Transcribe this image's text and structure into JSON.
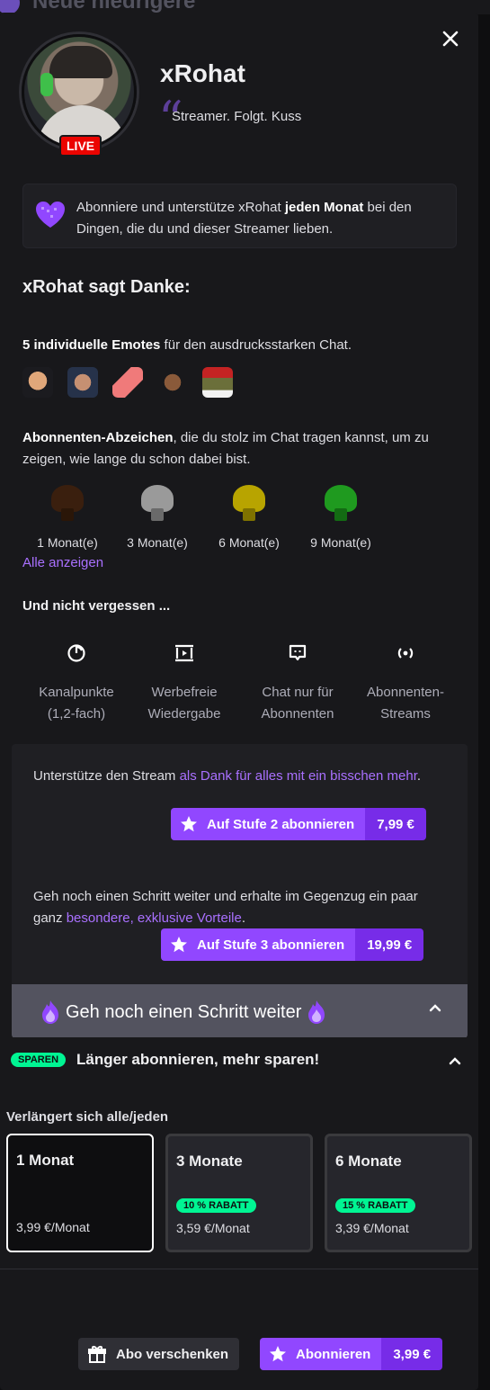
{
  "background_title": "Neue niedrigere",
  "channel": {
    "name": "xRohat",
    "tagline": "Streamer. Folgt. Kuss",
    "live_label": "LIVE"
  },
  "promo": {
    "pre": "Abonniere und unterstütze xRohat ",
    "bold": "jeden Monat",
    "post": " bei den Dingen, die du und dieser Streamer lieben."
  },
  "thanks_title": "xRohat sagt Danke:",
  "emotes_section": {
    "bold": "5 individuelle Emotes",
    "rest": " für den ausdrucksstarken Chat."
  },
  "badges_section": {
    "bold": "Abonnenten-Abzeichen",
    "rest": ", die du stolz im Chat tragen kannst, um zu zeigen, wie lange du schon dabei bist.",
    "badges": [
      {
        "label": "1 Monat(e)",
        "color": "#3a1f0e"
      },
      {
        "label": "3 Monat(e)",
        "color": "#9a9a9a"
      },
      {
        "label": "6 Monat(e)",
        "color": "#b8a400"
      },
      {
        "label": "9 Monat(e)",
        "color": "#1f9a1f"
      }
    ],
    "show_all": "Alle anzeigen"
  },
  "perks_title": "Und nicht vergessen ...",
  "perks": [
    {
      "icon": "clock-icon",
      "line1": "Kanalpunkte",
      "line2": "(1,2-fach)"
    },
    {
      "icon": "ad-free-icon",
      "line1": "Werbefreie",
      "line2": "Wiedergabe"
    },
    {
      "icon": "chat-icon",
      "line1": "Chat nur für",
      "line2": "Abonnenten"
    },
    {
      "icon": "broadcast-icon",
      "line1": "Abonnenten-",
      "line2": "Streams"
    }
  ],
  "tiers": {
    "tier2": {
      "text_pre": "Unterstütze den Stream ",
      "text_link": "als Dank für alles mit ein bisschen mehr",
      "text_post": ".",
      "button_label": "Auf Stufe 2 abonnieren",
      "price": "7,99 €"
    },
    "tier3": {
      "text_pre": "Geh noch einen Schritt weiter und erhalte im Gegenzug ein paar ganz ",
      "text_link": "besondere, exklusive Vorteile",
      "text_post": ".",
      "button_label": "Auf Stufe 3 abonnieren",
      "price": "19,99 €"
    },
    "step_further_label": "Geh noch einen Schritt weiter"
  },
  "savings": {
    "pill": "SPAREN",
    "title": "Länger abonnieren, mehr sparen!",
    "renews_label": "Verlängert sich alle/jeden",
    "plans": [
      {
        "name": "1 Monat",
        "discount": "",
        "price": "3,99 €/Monat",
        "selected": true
      },
      {
        "name": "3 Monate",
        "discount": "10 % RABATT",
        "price": "3,59 €/Monat",
        "selected": false
      },
      {
        "name": "6 Monate",
        "discount": "15 % RABATT",
        "price": "3,39 €/Monat",
        "selected": false
      }
    ]
  },
  "footer": {
    "gift_label": "Abo verschenken",
    "subscribe_label": "Abonnieren",
    "subscribe_price": "3,99 €"
  },
  "colors": {
    "accent": "#9147ff",
    "accent_dark": "#772ce8",
    "link": "#a970ff",
    "live": "#eb0400",
    "savings": "#00f593"
  }
}
